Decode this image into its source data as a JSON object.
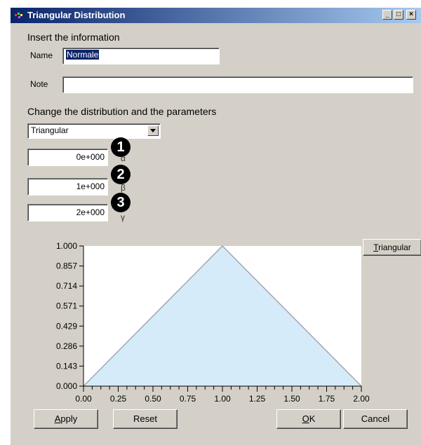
{
  "window": {
    "title": "Triangular Distribution",
    "controls": [
      "_",
      "□",
      "×"
    ]
  },
  "info_section": {
    "heading": "Insert the information",
    "name_label": "Name",
    "name_value": "Normale",
    "note_label": "Note",
    "note_value": ""
  },
  "distribution_section": {
    "heading": "Change the distribution and the parameters",
    "selected": "Triangular",
    "params": [
      {
        "value": "0e+000",
        "badge": "1",
        "symbol": "α"
      },
      {
        "value": "1e+000",
        "badge": "2",
        "symbol": "β"
      },
      {
        "value": "2e+000",
        "badge": "3",
        "symbol": "γ"
      }
    ]
  },
  "side_button": {
    "prefix": "",
    "accel": "T",
    "rest": "riangular"
  },
  "chart_data": {
    "type": "area",
    "x": [
      0.0,
      1.0,
      2.0
    ],
    "y": [
      0.0,
      1.0,
      0.0
    ],
    "xlim": [
      0.0,
      2.0
    ],
    "ylim": [
      0.0,
      1.0
    ],
    "xticks": [
      "0.00",
      "0.25",
      "0.50",
      "0.75",
      "1.00",
      "1.25",
      "1.50",
      "1.75",
      "2.00"
    ],
    "yticks": [
      "0.000",
      "0.143",
      "0.286",
      "0.429",
      "0.571",
      "0.714",
      "0.857",
      "1.000"
    ],
    "fill_color": "#d6ebfa",
    "line_color": "#a0a8b0"
  },
  "buttons": {
    "apply": {
      "accel": "A",
      "rest": "pply"
    },
    "reset": "Reset",
    "ok": {
      "accel": "O",
      "rest": "K"
    },
    "cancel": "Cancel"
  }
}
